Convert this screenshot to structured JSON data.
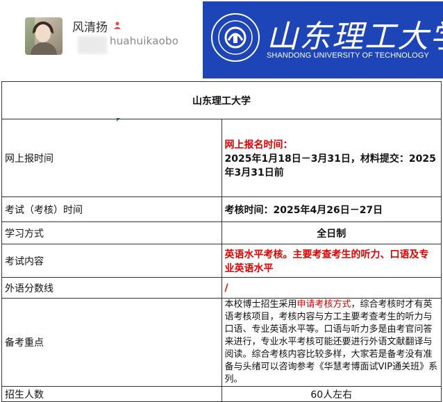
{
  "profile": {
    "name": "风清扬",
    "wechat_id": "huahuikaobo",
    "verify_icon": "person-icon"
  },
  "banner": {
    "school_name": "山东理工大学",
    "english_name": "SHANDONG UNIVERSITY OF TECHNOLOGY",
    "color": "#1d45b7"
  },
  "table": {
    "title": "山东理工大学",
    "rows": {
      "registration": {
        "label": "网上报时间",
        "heading": "网上报名时间：",
        "value": "2025年1月18日－3月31日，材料提交：2025年3月31日前"
      },
      "exam_time": {
        "label": "考试（考核）时间",
        "value": "考核时间：2025年4月26日－27日"
      },
      "study_mode": {
        "label": "学习方式",
        "value": "全日制"
      },
      "exam_content": {
        "label": "考试内容",
        "value": "英语水平考核。主要考查考生的听力、口语及专业英语水平"
      },
      "language_score": {
        "label": "外语分数线",
        "value": "/"
      },
      "prep_notes": {
        "label": "备考重点",
        "text_before": "本校博士招生采用",
        "highlight": "申请考核方式",
        "text_after": "，综合考核时才有英语考核项目，考核内容与方工主要考查考生的听力与口语、专业英语水平等。口语与听力多是由考官问答来进行，专业水平考核可能还要进行外语文献翻译与阅读。综合考核内容比较多样，大家若是备考没有准备与头绪可以咨询参考《华慧考博面试VIP通关班》系列。"
      },
      "enrollment": {
        "label": "招生人数",
        "value": "60人左右"
      }
    }
  },
  "colors": {
    "accent_red": "#e00000",
    "border": "#333333"
  }
}
